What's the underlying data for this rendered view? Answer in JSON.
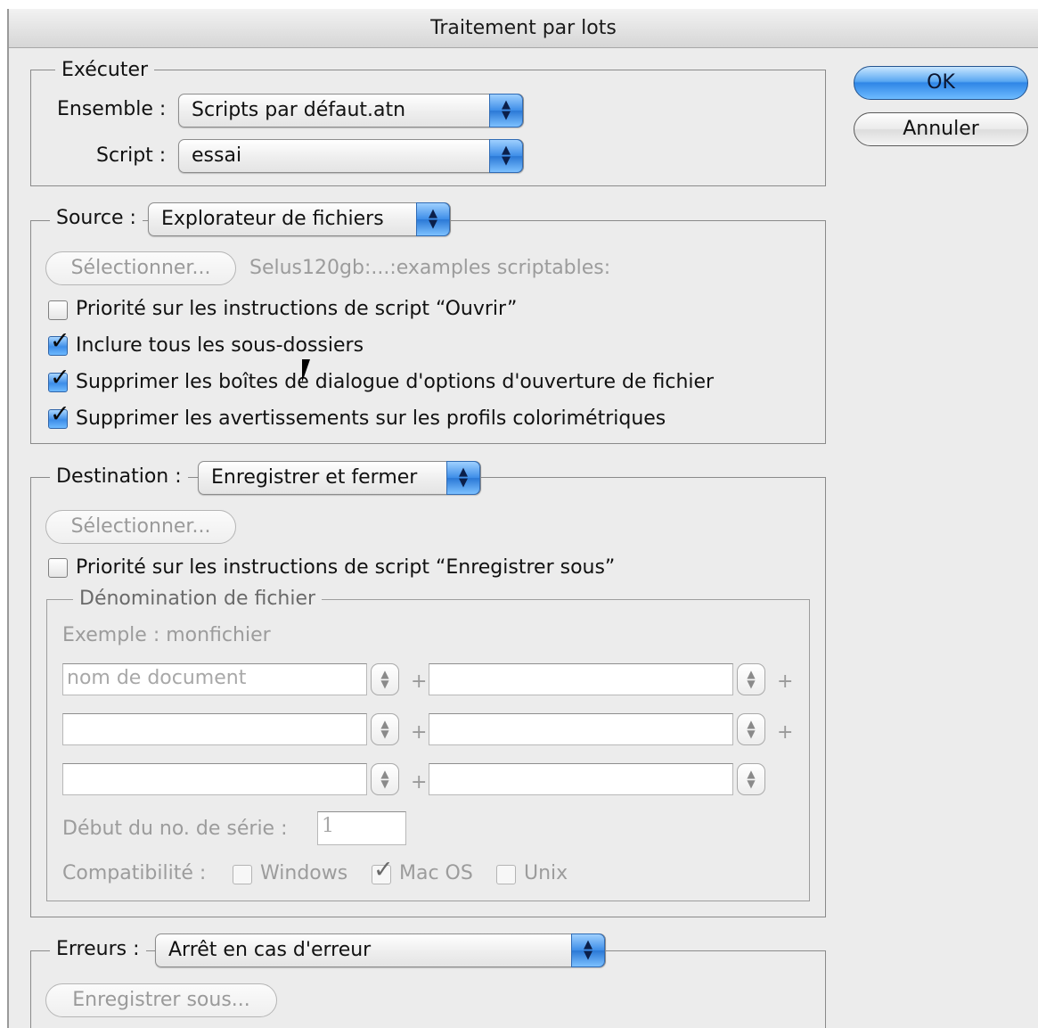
{
  "window": {
    "title": "Traitement par lots"
  },
  "buttons": {
    "ok": "OK",
    "cancel": "Annuler"
  },
  "execute": {
    "legend": "Exécuter",
    "set_label": "Ensemble :",
    "set_value": "Scripts par défaut.atn",
    "script_label": "Script :",
    "script_value": "essai"
  },
  "source": {
    "legend": "Source :",
    "value": "Explorateur de fichiers",
    "select_button": "Sélectionner...",
    "path": "Selus120gb:...:examples scriptables:",
    "options": [
      {
        "label": "Priorité sur les instructions de script “Ouvrir”",
        "checked": false
      },
      {
        "label": "Inclure tous les sous-dossiers",
        "checked": true
      },
      {
        "label": "Supprimer les boîtes de dialogue d'options d'ouverture de fichier",
        "checked": true
      },
      {
        "label": "Supprimer les avertissements sur les profils colorimétriques",
        "checked": true
      }
    ]
  },
  "destination": {
    "legend": "Destination :",
    "value": "Enregistrer et fermer",
    "select_button": "Sélectionner...",
    "override_label": "Priorité sur les instructions de script “Enregistrer sous”",
    "override_checked": false,
    "naming": {
      "legend": "Dénomination de fichier",
      "example": "Exemple : monfichier",
      "fields": [
        "nom de document",
        "",
        "",
        "",
        "",
        ""
      ],
      "plus": "+",
      "serial_label": "Début du no. de série :",
      "serial_value": "1",
      "compat_label": "Compatibilité :",
      "compat": [
        {
          "label": "Windows",
          "checked": false
        },
        {
          "label": "Mac OS",
          "checked": true
        },
        {
          "label": "Unix",
          "checked": false
        }
      ]
    }
  },
  "errors": {
    "legend": "Erreurs :",
    "value": "Arrêt en cas d'erreur",
    "save_button": "Enregistrer sous..."
  },
  "icons": {
    "popup_arrows": "up-down-arrows-icon",
    "checkmark": "checkmark-icon",
    "cursor": "mouse-pointer-icon"
  },
  "colors": {
    "accent": "#3d8de8",
    "window_bg": "#ececec",
    "disabled_text": "#9c9c9c"
  }
}
